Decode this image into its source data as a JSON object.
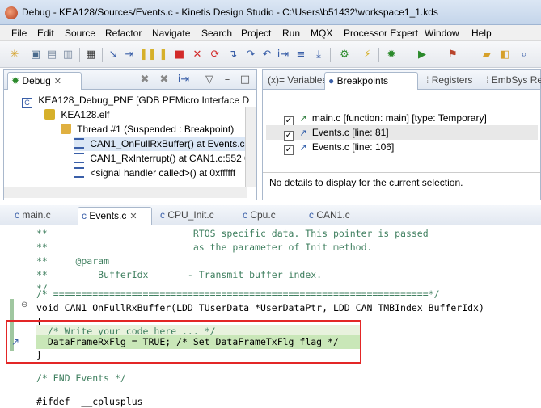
{
  "window": {
    "title": "Debug - KEA128/Sources/Events.c - Kinetis Design Studio - C:\\Users\\b51432\\workspace1_1.kds"
  },
  "menu": [
    "File",
    "Edit",
    "Source",
    "Refactor",
    "Navigate",
    "Search",
    "Project",
    "Run",
    "MQX",
    "Processor Expert",
    "Window",
    "Help"
  ],
  "debug_view": {
    "tab": "Debug",
    "tree": [
      "KEA128_Debug_PNE [GDB PEMicro Interface D",
      "KEA128.elf",
      "Thread #1 (Suspended : Breakpoint)",
      "CAN1_OnFullRxBuffer() at Events.c:",
      "CAN1_RxInterrupt() at CAN1.c:552 0",
      "<signal handler called>() at 0xffffff"
    ]
  },
  "right_view": {
    "tabs": [
      "(x)= Variables",
      "Breakpoints",
      "Registers",
      "EmbSys Re"
    ],
    "breakpoints": [
      "main.c [function: main] [type: Temporary]",
      "Events.c [line: 81]",
      "Events.c [line: 106]"
    ],
    "details": "No details to display for the current selection."
  },
  "editor": {
    "tabs": [
      "main.c",
      "Events.c",
      "CPU_Init.c",
      "Cpu.c",
      "CAN1.c"
    ],
    "lines": [
      "**                          RTOS specific data. This pointer is passed",
      "**                          as the parameter of Init method.",
      "**     @param",
      "**         BufferIdx       - Transmit buffer index.",
      "*/",
      "/* ===================================================================*/",
      "void CAN1_OnFullRxBuffer(LDD_TUserData *UserDataPtr, LDD_CAN_TMBIndex BufferIdx)",
      "{",
      "  /* Write your code here ... */",
      "  DataFrameRxFlg = TRUE; /* Set DataFrameTxFlg flag */",
      "}",
      "",
      "/* END Events */",
      "",
      "#ifdef  __cplusplus"
    ]
  }
}
